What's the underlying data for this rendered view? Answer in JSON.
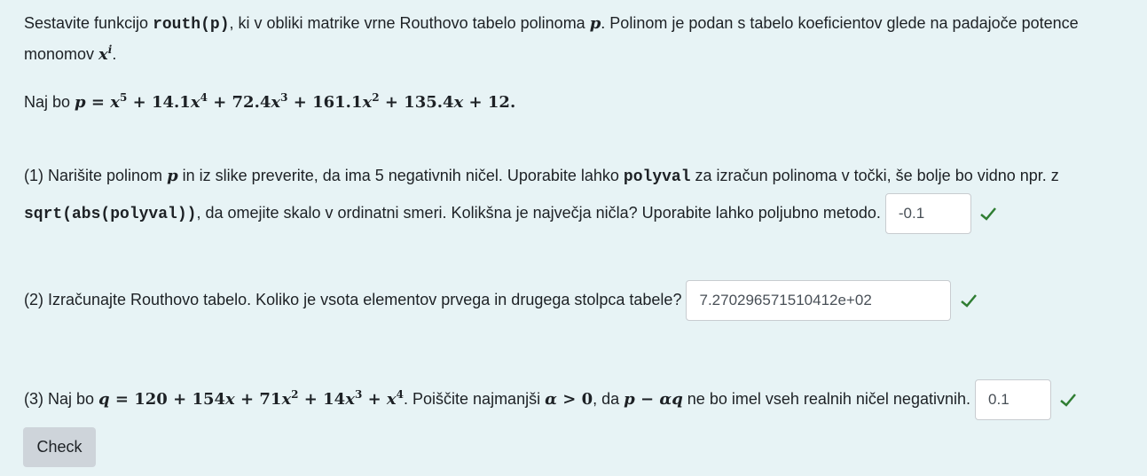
{
  "intro": {
    "text_a": "Sestavite funkcijo ",
    "func": "routh(p)",
    "text_b": ", ki v obliki matrike vrne Routhovo tabelo polinoma ",
    "var_p": "p",
    "text_c": ". Polinom je podan s tabelo koeficientov glede na padajoče potence monomov ",
    "monom": "x",
    "monom_exp": "i",
    "text_d": "."
  },
  "poly": {
    "prefix": "Naj bo ",
    "p": "p",
    "eq": " = ",
    "x": "x",
    "e5": "5",
    "c4": " + 14.1",
    "e4": "4",
    "c3": " + 72.4",
    "e3": "3",
    "c2": " + 161.1",
    "e2": "2",
    "c1": " + 135.4",
    "c0": " + 12",
    "end": "."
  },
  "q1": {
    "a": "(1) Narišite polinom ",
    "p": "p",
    "b": " in iz slike preverite, da ima 5 negativnih ničel. Uporabite lahko ",
    "code1": "polyval",
    "c": " za izračun polinoma v točki, še bolje bo vidno npr. z ",
    "code2": "sqrt(abs(polyval))",
    "d": ", da omejite skalo v ordinatni smeri. Kolikšna je največja ničla? Uporabite lahko poljubno metodo.",
    "answer": "-0.1"
  },
  "q2": {
    "a": "(2) Izračunajte Routhovo tabelo. Koliko je vsota elementov prvega in drugega stolpca tabele?",
    "answer": "7.270296571510412e+02"
  },
  "q3": {
    "a": "(3) Naj bo ",
    "q": "q",
    "q_expr": " = 120 + 154",
    "x": "x",
    "t2": " + 71",
    "e2": "2",
    "t3": " + 14",
    "e3": "3",
    "t4": " + ",
    "e4": "4",
    "b": ". Poiščite najmanjši ",
    "alpha": "α",
    "gt": " > 0",
    "c": ", da ",
    "pmaq_p": "p",
    "pmaq_mid": " − ",
    "pmaq_a": "α",
    "pmaq_q": "q",
    "d": " ne bo imel vseh realnih ničel negativnih.",
    "answer": "0.1"
  },
  "check_button": "Check",
  "colors": {
    "background": "#e7f3f5",
    "correct": "#2f7d32",
    "button": "#ced4da"
  },
  "icons": [
    "check-icon"
  ]
}
